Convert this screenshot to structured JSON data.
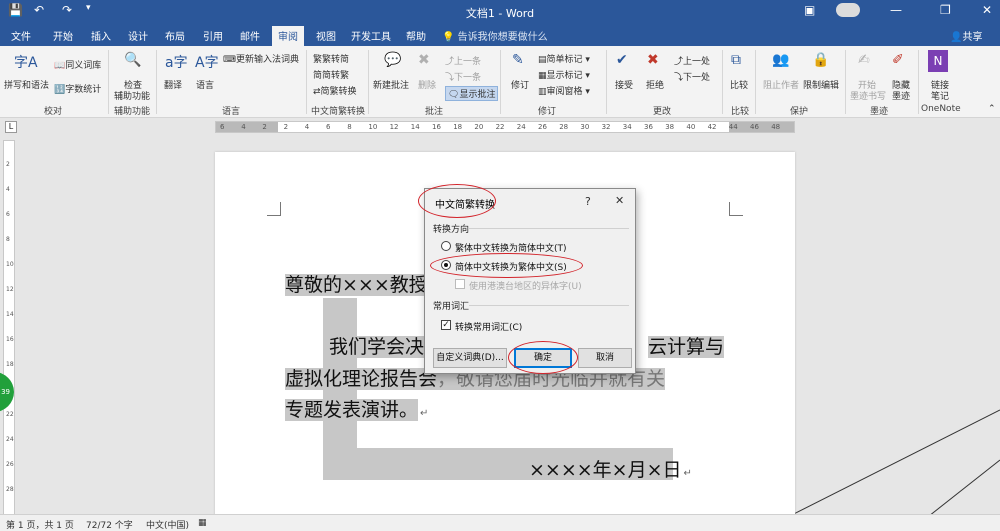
{
  "window": {
    "title": "文档1 - Word"
  },
  "tabs": [
    "文件",
    "开始",
    "插入",
    "设计",
    "布局",
    "引用",
    "邮件",
    "审阅",
    "视图",
    "开发工具",
    "帮助"
  ],
  "active_tab": "审阅",
  "tell_me": "告诉我你想要做什么",
  "share": "共享",
  "ribbon": {
    "proofing": {
      "spell": "拼写和语法",
      "thesaurus": "同义词库",
      "wordcount": "字数统计",
      "label": "校对"
    },
    "accessibility": {
      "check": "检查",
      "check2": "辅助功能",
      "label": "辅助功能"
    },
    "language": {
      "translate": "翻译",
      "language": "语言",
      "ime": "更新输入法词典",
      "label": "语言"
    },
    "chinese": {
      "to_trad": "繁转简",
      "to_simp": "简转繁",
      "convert": "简繁转换",
      "label": "中文简繁转换"
    },
    "comments": {
      "new": "新建批注",
      "delete": "删除",
      "prev": "上一条",
      "next": "下一条",
      "show": "显示批注",
      "label": "批注"
    },
    "tracking": {
      "track": "修订",
      "markup": "简单标记",
      "show_markup": "显示标记",
      "pane": "审阅窗格",
      "label": "修订"
    },
    "changes": {
      "accept": "接受",
      "reject": "拒绝",
      "prev": "上一处",
      "next": "下一处",
      "label": "更改"
    },
    "compare": {
      "compare": "比较",
      "label": "比较"
    },
    "protect": {
      "block": "阻止作者",
      "restrict": "限制编辑",
      "label": "保护"
    },
    "ink": {
      "start": "开始",
      "start2": "墨迹书写",
      "hide": "隐藏",
      "hide2": "墨迹",
      "label": "墨迹"
    },
    "onenote": {
      "linked": "链接",
      "linked2": "笔记",
      "label": "OneNote"
    }
  },
  "ruler": {
    "h_ticks": [
      "6",
      "4",
      "2",
      "2",
      "4",
      "6",
      "8",
      "10",
      "12",
      "14",
      "16",
      "18",
      "20",
      "22",
      "24",
      "26",
      "28",
      "30",
      "32",
      "34",
      "36",
      "38",
      "40",
      "42",
      "44",
      "46",
      "48"
    ],
    "v_ticks": [
      "2",
      "4",
      "6",
      "8",
      "10",
      "12",
      "14",
      "16",
      "18",
      "20",
      "22",
      "24",
      "26",
      "28"
    ]
  },
  "document": {
    "line1": "尊敬的×××教授",
    "line2a": "我们学会决定",
    "line2b": "云计算与",
    "line3a": "虚拟化理论报告会",
    "line3b": "，敬请您届时光临并就有关",
    "line4": "专题发表演讲。",
    "date": "××××年×月×日",
    "para_mark": "↵"
  },
  "dialog": {
    "title": "中文简繁转换",
    "help": "?",
    "close": "✕",
    "direction_group": "转换方向",
    "opt_t2s": "繁体中文转换为简体中文(T)",
    "opt_s2t": "简体中文转换为繁体中文(S)",
    "opt_hk": "使用港澳台地区的异体字(U)",
    "vocab_group": "常用词汇",
    "convert_vocab": "转换常用词汇(C)",
    "custom_dict": "自定义词典(D)...",
    "ok": "确定",
    "cancel": "取消"
  },
  "status": {
    "page": "第 1 页，共 1 页",
    "words": "72/72 个字",
    "lang": "中文(中国)"
  },
  "side_badge": "39",
  "colors": {
    "titlebar": "#2b579a",
    "highlight": "#c7c7c7",
    "annotation": "#d2232a"
  }
}
